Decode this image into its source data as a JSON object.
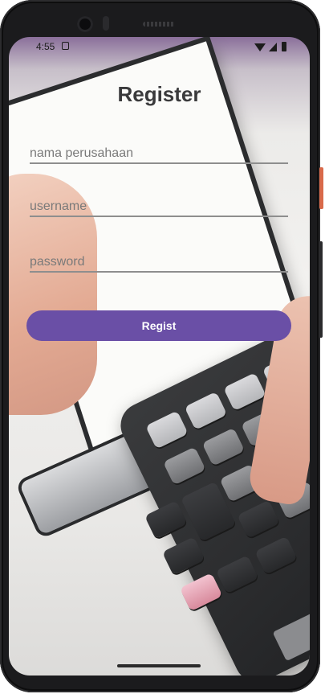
{
  "status_bar": {
    "time": "4:55"
  },
  "register": {
    "title": "Register",
    "company_placeholder": "nama perusahaan",
    "username_placeholder": "username",
    "password_placeholder": "password",
    "submit_label": "Regist"
  },
  "colors": {
    "accent": "#6a4fa6",
    "title": "#3a3a3c"
  },
  "icons": [
    "notification-icon",
    "wifi-icon",
    "signal-icon",
    "battery-icon"
  ]
}
